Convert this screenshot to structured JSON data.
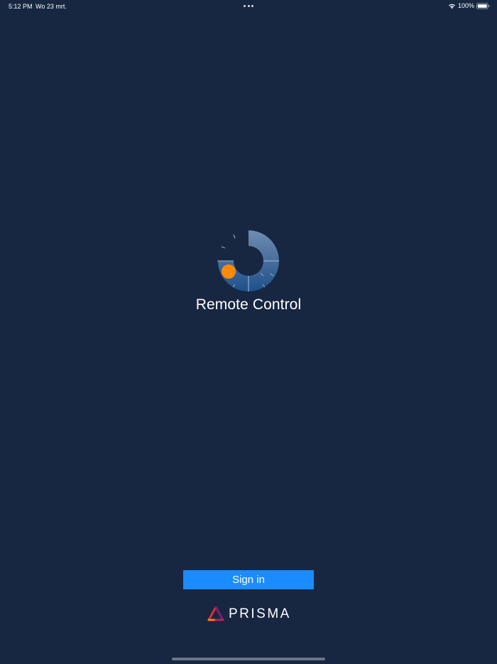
{
  "status_bar": {
    "time": "5:12 PM",
    "date": "Wo 23 mrt.",
    "battery_percent": "100%",
    "icons": [
      "multitasking-dots-icon",
      "wifi-icon",
      "battery-icon"
    ]
  },
  "app": {
    "title": "Remote Control",
    "logo_icon": "remote-control-dial-logo"
  },
  "sign_in": {
    "label": "Sign in"
  },
  "brand": {
    "name": "PRISMA",
    "logo_icon": "prisma-triangle-logo"
  },
  "colors": {
    "background": "#172641",
    "button": "#1a8cff",
    "accent_orange": "#ff8a0a",
    "text": "#ffffff"
  }
}
